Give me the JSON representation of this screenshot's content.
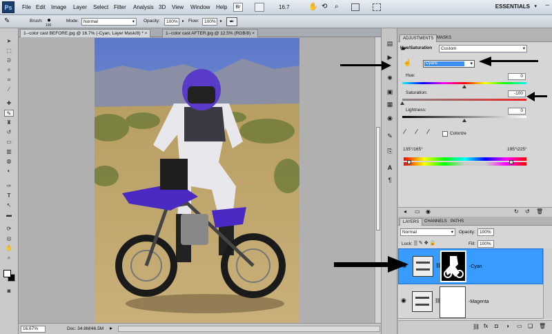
{
  "menubar": {
    "app_logo": "Ps",
    "items": [
      "File",
      "Edit",
      "Image",
      "Layer",
      "Select",
      "Filter",
      "Analysis",
      "3D",
      "View",
      "Window",
      "Help"
    ],
    "zoom": "16.7",
    "workspace": "ESSENTIALS"
  },
  "options": {
    "brush_label": "Brush:",
    "brush_size": "100",
    "mode_label": "Mode:",
    "mode_value": "Normal",
    "opacity_label": "Opacity:",
    "opacity_value": "100%",
    "flow_label": "Flow:",
    "flow_value": "100%"
  },
  "doc_tabs": [
    {
      "label": "1--color cast BEFORE.jpg @ 16.7% (-Cyan, Layer Mask/8) *",
      "active": true
    },
    {
      "label": "1--color cast AFTER.jpg @ 12.5% (RGB/8)",
      "active": false
    }
  ],
  "status": {
    "zoom": "16.67%",
    "doc": "Doc: 34.8M/46.5M"
  },
  "adjustments": {
    "tabs": [
      "ADJUSTMENTS",
      "MASKS"
    ],
    "title": "Hue/Saturation",
    "preset": "Custom",
    "channel": "Cyans",
    "hue_label": "Hue:",
    "hue_value": "0",
    "saturation_label": "Saturation:",
    "saturation_value": "-100",
    "lightness_label": "Lightness:",
    "lightness_value": "0",
    "colorize_label": "Colorize",
    "range_left": "135°/165°",
    "range_right": "195°\\225°"
  },
  "layers": {
    "tabs": [
      "LAYERS",
      "CHANNELS",
      "PATHS"
    ],
    "blend_mode": "Normal",
    "opacity_label": "Opacity:",
    "opacity_value": "100%",
    "lock_label": "Lock:",
    "fill_label": "Fill:",
    "fill_value": "100%",
    "items": [
      {
        "name": "-Cyan",
        "selected": true
      },
      {
        "name": "-Magenta",
        "selected": false
      }
    ]
  },
  "colors": {
    "accent": "#3399ff",
    "selected_layer": "#3a9bff",
    "channel_dropdown": "#3c8ef0"
  }
}
